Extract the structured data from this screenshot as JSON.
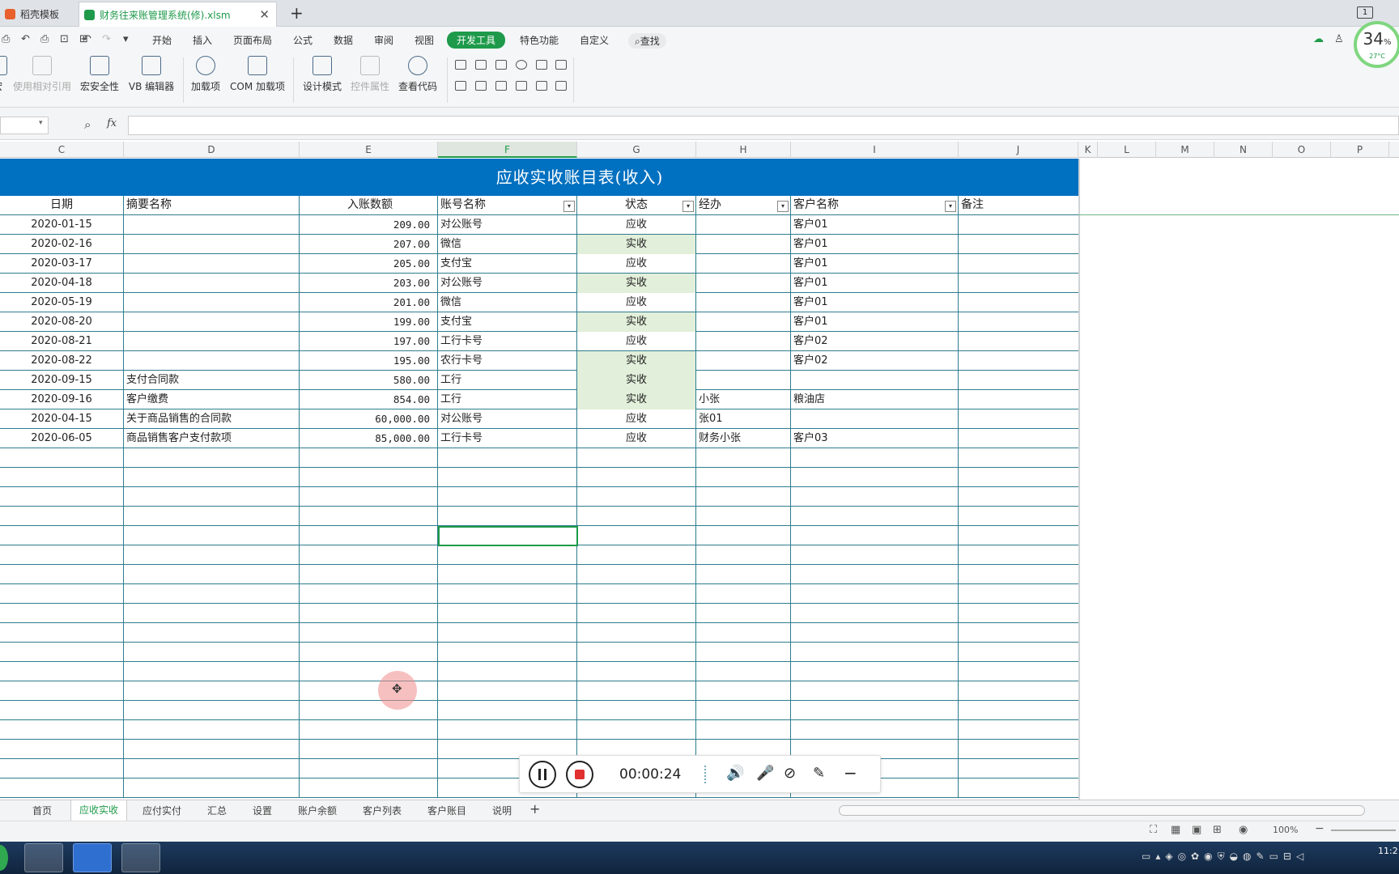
{
  "tabs": [
    {
      "label": "稻壳模板"
    },
    {
      "label": "财务往来账管理系统(修).xlsm"
    }
  ],
  "window_count": "1",
  "quick_access": [
    "⎙",
    "↶",
    "⎙",
    "⊡",
    "⊞",
    "↶",
    "↷",
    "▾"
  ],
  "menus": [
    "开始",
    "插入",
    "页面布局",
    "公式",
    "数据",
    "审阅",
    "视图",
    "开发工具",
    "特色功能",
    "自定义"
  ],
  "active_menu": "开发工具",
  "search_label": "查找",
  "ribbon": {
    "buttons": [
      {
        "label": "宏"
      },
      {
        "label": "使用相对引用",
        "disabled": true
      },
      {
        "label": "宏安全性"
      },
      {
        "label": "VB 编辑器"
      },
      {
        "label": "加载项"
      },
      {
        "label": "COM 加载项"
      },
      {
        "label": "设计模式"
      },
      {
        "label": "控件属性",
        "disabled": true
      },
      {
        "label": "查看代码"
      }
    ]
  },
  "formula_bar": {
    "fx": "fx",
    "namebox": "",
    "value": ""
  },
  "speed_widget": {
    "value": "34",
    "unit": "%",
    "temp": "27°C"
  },
  "columns": [
    "C",
    "D",
    "E",
    "F",
    "G",
    "H",
    "I",
    "J",
    "K",
    "L",
    "M",
    "N",
    "O",
    "P"
  ],
  "selected_column": "F",
  "sheet_title": "应收实收账目表(收入)",
  "headers": {
    "date": "日期",
    "summary": "摘要名称",
    "amount": "入账数额",
    "account": "账号名称",
    "status": "状态",
    "handler": "经办",
    "customer": "客户名称",
    "note": "备注"
  },
  "rows": [
    {
      "date": "2020-01-15",
      "summary": "",
      "amount": "209.00",
      "account": "对公账号",
      "status": "应收",
      "handler": "",
      "customer": "客户01",
      "note": ""
    },
    {
      "date": "2020-02-16",
      "summary": "",
      "amount": "207.00",
      "account": "微信",
      "status": "实收",
      "handler": "",
      "customer": "客户01",
      "note": ""
    },
    {
      "date": "2020-03-17",
      "summary": "",
      "amount": "205.00",
      "account": "支付宝",
      "status": "应收",
      "handler": "",
      "customer": "客户01",
      "note": ""
    },
    {
      "date": "2020-04-18",
      "summary": "",
      "amount": "203.00",
      "account": "对公账号",
      "status": "实收",
      "handler": "",
      "customer": "客户01",
      "note": ""
    },
    {
      "date": "2020-05-19",
      "summary": "",
      "amount": "201.00",
      "account": "微信",
      "status": "应收",
      "handler": "",
      "customer": "客户01",
      "note": ""
    },
    {
      "date": "2020-08-20",
      "summary": "",
      "amount": "199.00",
      "account": "支付宝",
      "status": "实收",
      "handler": "",
      "customer": "客户01",
      "note": ""
    },
    {
      "date": "2020-08-21",
      "summary": "",
      "amount": "197.00",
      "account": "工行卡号",
      "status": "应收",
      "handler": "",
      "customer": "客户02",
      "note": ""
    },
    {
      "date": "2020-08-22",
      "summary": "",
      "amount": "195.00",
      "account": "农行卡号",
      "status": "实收",
      "handler": "",
      "customer": "客户02",
      "note": ""
    },
    {
      "date": "2020-09-15",
      "summary": "支付合同款",
      "amount": "580.00",
      "account": "工行",
      "status": "实收",
      "handler": "",
      "customer": "",
      "note": ""
    },
    {
      "date": "2020-09-16",
      "summary": "客户缴费",
      "amount": "854.00",
      "account": "工行",
      "status": "实收",
      "handler": "小张",
      "customer": "粮油店",
      "note": ""
    },
    {
      "date": "2020-04-15",
      "summary": "关于商品销售的合同款",
      "amount": "60,000.00",
      "account": "对公账号",
      "status": "应收",
      "handler": "张01",
      "customer": "",
      "note": ""
    },
    {
      "date": "2020-06-05",
      "summary": "商品销售客户支付款项",
      "amount": "85,000.00",
      "account": "工行卡号",
      "status": "应收",
      "handler": "财务小张",
      "customer": "客户03",
      "note": ""
    }
  ],
  "recorder": {
    "time": "00:00:24"
  },
  "sheet_tabs": [
    "首页",
    "应收实收",
    "应付实付",
    "汇总",
    "设置",
    "账户余额",
    "客户列表",
    "客户账目",
    "说明"
  ],
  "active_sheet": "应收实收",
  "zoom": "100%",
  "clock": "11:2"
}
